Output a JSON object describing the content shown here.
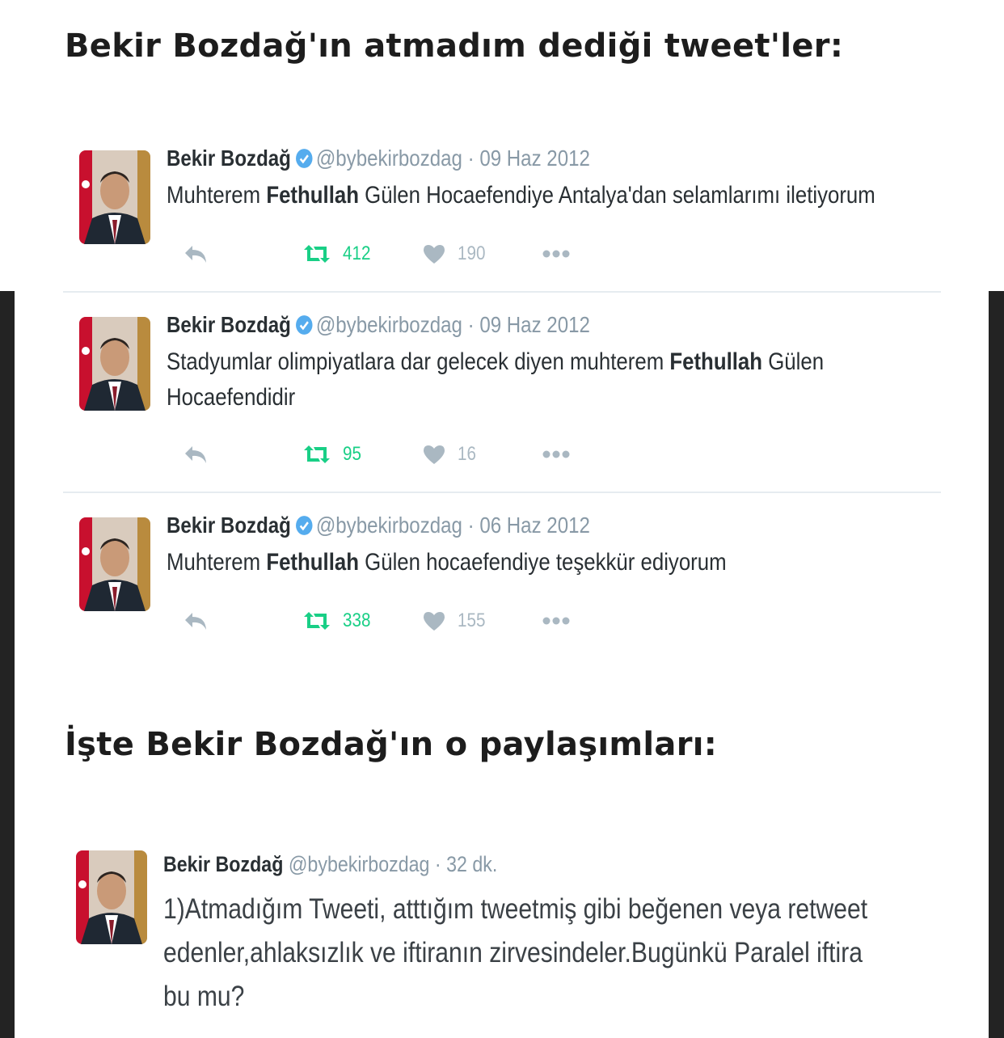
{
  "heading1": "Bekir Bozdağ'ın atmadım dediği tweet'ler:",
  "heading2": "İşte Bekir Bozdağ'ın o paylaşımları:",
  "colors": {
    "verified": "#55acee",
    "retweet": "#19cf86",
    "muted": "#aab8c2",
    "text": "#292f33",
    "meta": "#8899a6"
  },
  "icons": [
    "verified-badge-icon",
    "reply-icon",
    "retweet-icon",
    "like-heart-icon",
    "more-dots-icon"
  ],
  "tweets": [
    {
      "name": "Bekir Bozdağ",
      "meta": "@bybekirbozdag · 09 Haz 2012",
      "text_before": "Muhterem ",
      "text_bold": "Fethullah",
      "text_after": " Gülen Hocaefendiye Antalya'dan selamlarımı iletiyorum",
      "retweets": "412",
      "likes": "190"
    },
    {
      "name": "Bekir Bozdağ",
      "meta": "@bybekirbozdag · 09 Haz 2012",
      "text_before": "Stadyumlar olimpiyatlara dar gelecek diyen muhterem ",
      "text_bold": "Fethullah",
      "text_after": " Gülen Hocaefendidir",
      "retweets": "95",
      "likes": "16"
    },
    {
      "name": "Bekir Bozdağ",
      "meta": "@bybekirbozdag · 06 Haz 2012",
      "text_before": "Muhterem ",
      "text_bold": "Fethullah",
      "text_after": " Gülen hocaefendiye teşekkür ediyorum",
      "retweets": "338",
      "likes": "155"
    }
  ],
  "tweet4": {
    "name": "Bekir Bozdağ",
    "meta": "@bybekirbozdag · 32 dk.",
    "text": "1)Atmadığım Tweeti, atttığım tweetmiş gibi beğenen veya retweet edenler,ahlaksızlık ve iftiranın zirvesindeler.Bugünkü Paralel iftira bu mu?"
  }
}
